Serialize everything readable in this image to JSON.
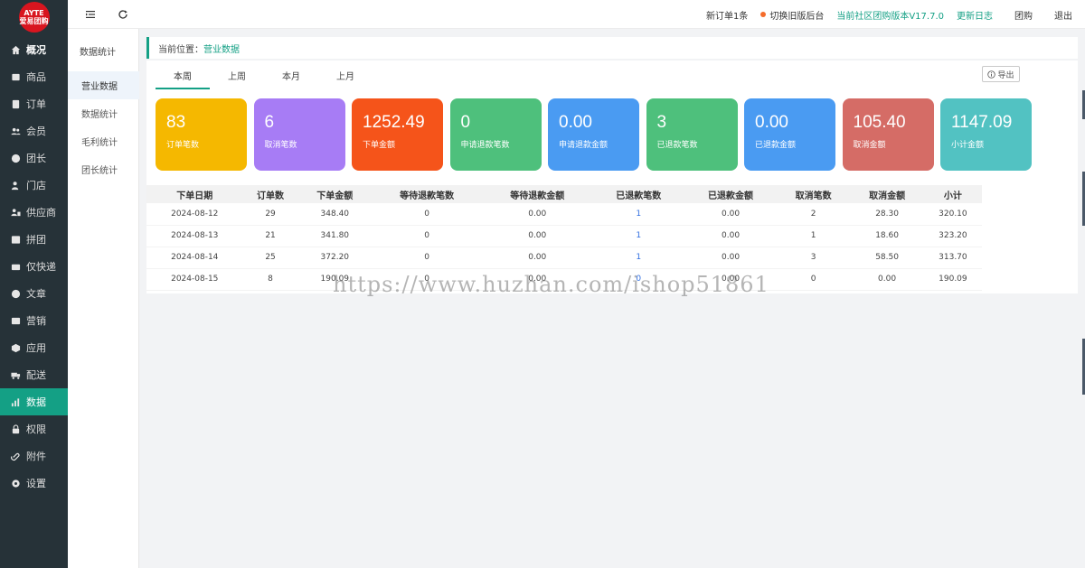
{
  "logo": {
    "top_text": "AYTE",
    "bottom_text": "爱易团购"
  },
  "sidebar": {
    "items": [
      {
        "label": "概况",
        "icon": "home-icon"
      },
      {
        "label": "商品",
        "icon": "box-icon"
      },
      {
        "label": "订单",
        "icon": "order-icon"
      },
      {
        "label": "会员",
        "icon": "users-icon"
      },
      {
        "label": "团长",
        "icon": "leader-icon"
      },
      {
        "label": "门店",
        "icon": "store-icon"
      },
      {
        "label": "供应商",
        "icon": "supplier-icon"
      },
      {
        "label": "拼团",
        "icon": "group-icon"
      },
      {
        "label": "仅快递",
        "icon": "express-icon"
      },
      {
        "label": "文章",
        "icon": "article-icon"
      },
      {
        "label": "营销",
        "icon": "marketing-icon"
      },
      {
        "label": "应用",
        "icon": "app-icon"
      },
      {
        "label": "配送",
        "icon": "truck-icon"
      },
      {
        "label": "数据",
        "icon": "chart-icon"
      },
      {
        "label": "权限",
        "icon": "lock-icon"
      },
      {
        "label": "附件",
        "icon": "attachment-icon"
      },
      {
        "label": "设置",
        "icon": "gear-icon"
      }
    ]
  },
  "subnav": {
    "title": "数据统计",
    "items": [
      "营业数据",
      "数据统计",
      "毛利统计",
      "团长统计"
    ]
  },
  "topbar": {
    "new_order": "新订单1条",
    "switch_old": "切换旧版后台",
    "version": "当前社区团购版本V17.7.0",
    "changelog": "更新日志",
    "group_buy": "团购",
    "logout": "退出"
  },
  "breadcrumb": {
    "prefix": "当前位置：",
    "current": "营业数据"
  },
  "tabs": [
    "本周",
    "上周",
    "本月",
    "上月"
  ],
  "export_label": "导出",
  "cards": [
    {
      "value": "83",
      "label": "订单笔数",
      "color": "#f5b800"
    },
    {
      "value": "6",
      "label": "取消笔数",
      "color": "#a77cf5"
    },
    {
      "value": "1252.49",
      "label": "下单金额",
      "color": "#f5541a"
    },
    {
      "value": "0",
      "label": "申请退款笔数",
      "color": "#4ec07c"
    },
    {
      "value": "0.00",
      "label": "申请退款金额",
      "color": "#4a9bf2"
    },
    {
      "value": "3",
      "label": "已退款笔数",
      "color": "#4ec07c"
    },
    {
      "value": "0.00",
      "label": "已退款金额",
      "color": "#4a9bf2"
    },
    {
      "value": "105.40",
      "label": "取消金额",
      "color": "#d56c66"
    },
    {
      "value": "1147.09",
      "label": "小计金额",
      "color": "#52c2c2"
    }
  ],
  "table": {
    "headers": [
      "下单日期",
      "订单数",
      "下单金额",
      "等待退款笔数",
      "等待退款金额",
      "已退款笔数",
      "已退款金额",
      "取消笔数",
      "取消金额",
      "小计"
    ],
    "rows": [
      [
        "2024-08-12",
        "29",
        "348.40",
        "0",
        "0.00",
        "1",
        "0.00",
        "2",
        "28.30",
        "320.10"
      ],
      [
        "2024-08-13",
        "21",
        "341.80",
        "0",
        "0.00",
        "1",
        "0.00",
        "1",
        "18.60",
        "323.20"
      ],
      [
        "2024-08-14",
        "25",
        "372.20",
        "0",
        "0.00",
        "1",
        "0.00",
        "3",
        "58.50",
        "313.70"
      ],
      [
        "2024-08-15",
        "8",
        "190.09",
        "0",
        "0.00",
        "0",
        "0.00",
        "0",
        "0.00",
        "190.09"
      ]
    ]
  },
  "watermark": "https://www.huzhan.com/ishop51861"
}
